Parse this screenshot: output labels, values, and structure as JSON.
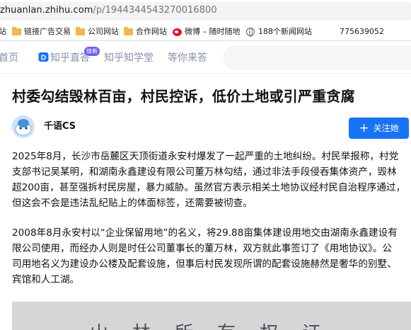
{
  "browser": {
    "url_host": "zhuanlan.zhihu.com",
    "url_path": "/p/1944344543270016800",
    "bookmarks": [
      {
        "label": "站",
        "icon": "folder-icon"
      },
      {
        "label": "链接广告交易",
        "icon": "folder-icon"
      },
      {
        "label": "公司网站",
        "icon": "folder-icon"
      },
      {
        "label": "合作网站",
        "icon": "folder-icon"
      },
      {
        "label": "微博 – 随时随地",
        "icon": "weibo-icon"
      },
      {
        "label": "188个新闻网站",
        "icon": "globe-icon"
      },
      {
        "label": "775639052",
        "icon": ""
      }
    ]
  },
  "nav": {
    "home": "首页",
    "zhida": "知乎直答",
    "zhida_badge": "焕新",
    "xuetang": "知乎知学堂",
    "waiting": "等你来答"
  },
  "article": {
    "title": "村委勾结毁林百亩，村民控诉，低价土地或引严重贪腐",
    "author": "千语CS",
    "follow_label": "关注她",
    "paragraph1_lines": [
      "2025年8月，长沙市岳麓区天顶街道永安村爆发了一起严重的土地纠纷。村民举报称，村党",
      "支部书记吴某明，和湖南永鑫建设有限公司董万林勾结，通过非法手段侵吞集体资产，毁林",
      "超200亩，甚至强拆村民房屋，暴力威胁。虽然官方表示相关土地协议经村民自治程序通过，",
      "但这会不会是违法乱纪贴上的体面标签，还需要被彻查。"
    ],
    "paragraph2_lines": [
      "2008年8月永安村以“企业保留用地”的名义，将29.88亩集体建设用地交由湖南永鑫建设有",
      "限公司使用，而经办人则是时任公司董事长的董万林，双方就此事签订了《用地协议》。公",
      "司用地名义为建设办公楼及配套设施，但事后村民发现所谓的配套设施赫然是奢华的别墅、",
      "宾馆和人工湖。"
    ],
    "photo_text": "山林所有权证"
  }
}
